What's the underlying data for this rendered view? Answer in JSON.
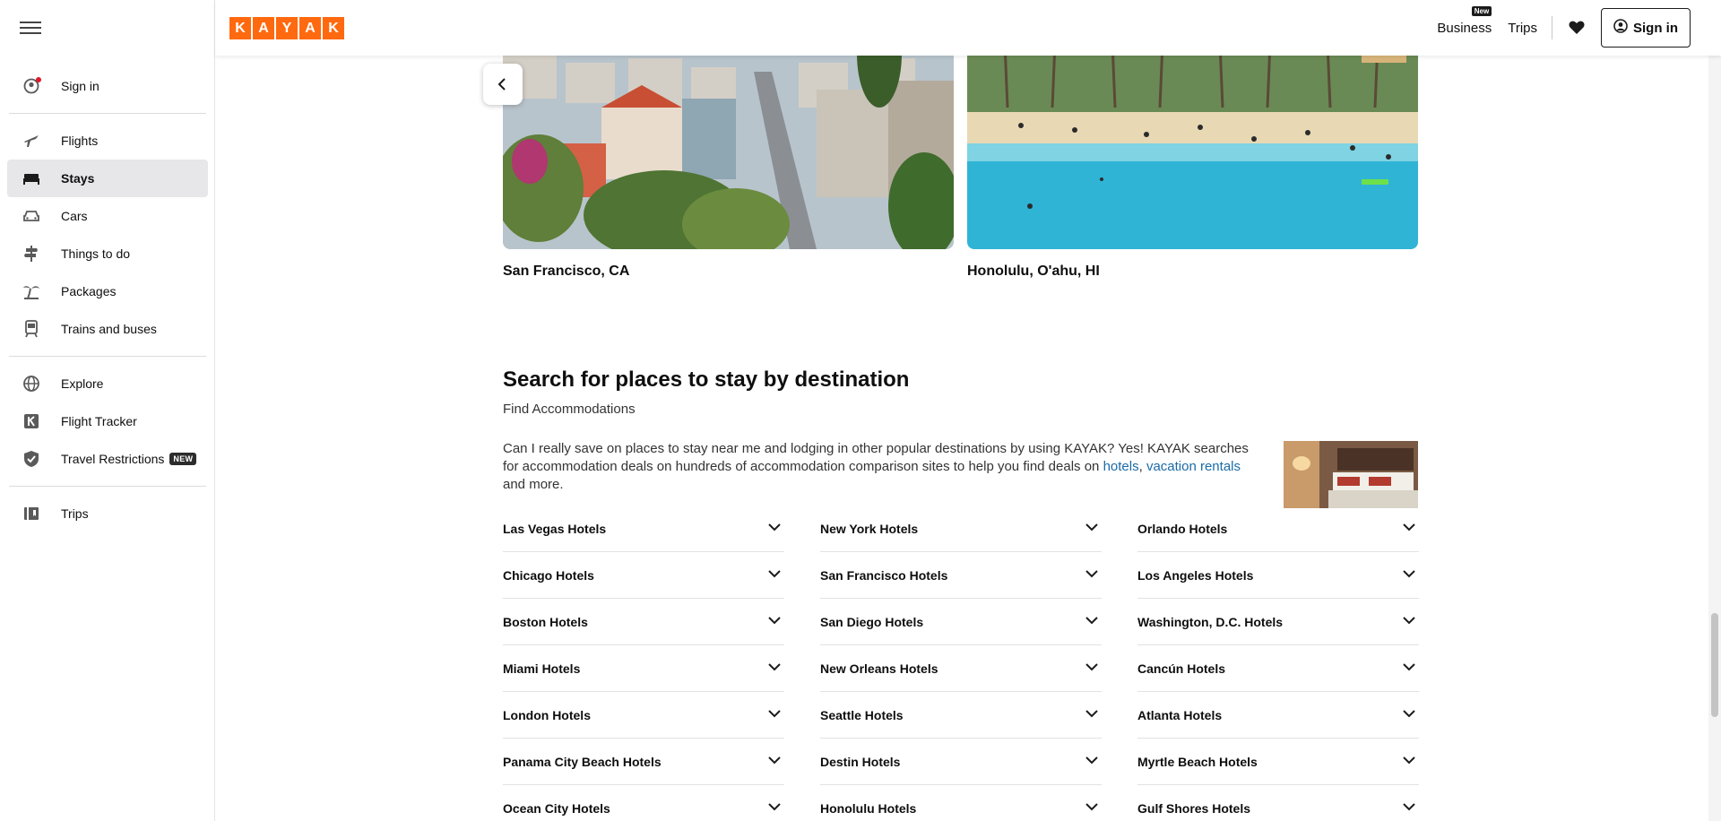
{
  "header": {
    "logo_letters": [
      "K",
      "A",
      "Y",
      "A",
      "K"
    ],
    "business": "Business",
    "business_badge": "New",
    "trips": "Trips",
    "signin": "Sign in"
  },
  "sidebar": {
    "items": [
      {
        "label": "Sign in",
        "icon": "user-icon"
      },
      {
        "label": "Flights",
        "icon": "plane-icon"
      },
      {
        "label": "Stays",
        "icon": "bed-icon",
        "active": true
      },
      {
        "label": "Cars",
        "icon": "car-icon"
      },
      {
        "label": "Things to do",
        "icon": "signpost-icon"
      },
      {
        "label": "Packages",
        "icon": "palm-icon"
      },
      {
        "label": "Trains and buses",
        "icon": "train-icon"
      },
      {
        "label": "Explore",
        "icon": "globe-icon"
      },
      {
        "label": "Flight Tracker",
        "icon": "k-icon"
      },
      {
        "label": "Travel Restrictions",
        "icon": "shield-icon",
        "badge": "NEW"
      },
      {
        "label": "Trips",
        "icon": "trips-icon"
      }
    ]
  },
  "cards": [
    {
      "caption": "San Francisco, CA"
    },
    {
      "caption": "Honolulu, O'ahu, HI"
    }
  ],
  "section": {
    "title": "Search for places to stay by destination",
    "subtitle": "Find Accommodations",
    "desc_part1": "Can I really save on places to stay near me and lodging in other popular destinations by using KAYAK? Yes! KAYAK searches for accommodation deals on hundreds of accommodation comparison sites to help you find deals on ",
    "link_hotels": "hotels",
    "desc_comma": ",",
    "link_vacation": "vacation rentals",
    "desc_part2": " and more."
  },
  "destinations": [
    "Las Vegas Hotels",
    "New York Hotels",
    "Orlando Hotels",
    "Chicago Hotels",
    "San Francisco Hotels",
    "Los Angeles Hotels",
    "Boston Hotels",
    "San Diego Hotels",
    "Washington, D.C. Hotels",
    "Miami Hotels",
    "New Orleans Hotels",
    "Cancún Hotels",
    "London Hotels",
    "Seattle Hotels",
    "Atlanta Hotels",
    "Panama City Beach Hotels",
    "Destin Hotels",
    "Myrtle Beach Hotels",
    "Ocean City Hotels",
    "Honolulu Hotels",
    "Gulf Shores Hotels"
  ],
  "colors": {
    "brand": "#ff690f",
    "link": "#1a6ba8",
    "active_bg": "#e7e7ea"
  }
}
